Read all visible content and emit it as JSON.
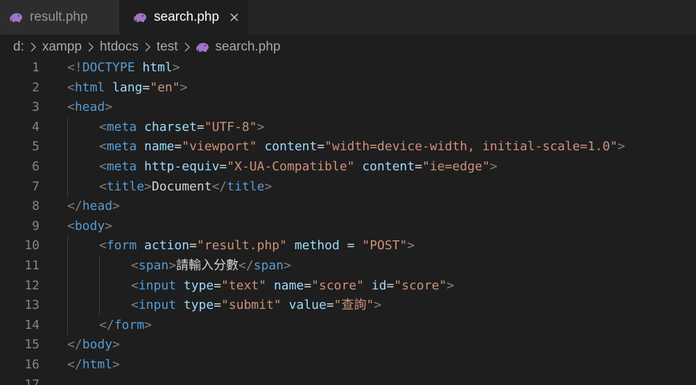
{
  "tabs": [
    {
      "label": "result.php",
      "active": false,
      "icon": "php-elephant-icon"
    },
    {
      "label": "search.php",
      "active": true,
      "icon": "php-elephant-icon",
      "close_icon": "close-icon"
    }
  ],
  "breadcrumb": {
    "items": [
      "d:",
      "xampp",
      "htdocs",
      "test"
    ],
    "file": "search.php",
    "separator_icon": "chevron-right-icon"
  },
  "editor": {
    "lines": [
      {
        "n": "1",
        "indent": 0,
        "tokens": [
          {
            "t": "punc",
            "v": "<!"
          },
          {
            "t": "tag",
            "v": "DOCTYPE"
          },
          {
            "t": "text",
            "v": " "
          },
          {
            "t": "attr",
            "v": "html"
          },
          {
            "t": "punc",
            "v": ">"
          }
        ]
      },
      {
        "n": "2",
        "indent": 0,
        "tokens": [
          {
            "t": "punc",
            "v": "<"
          },
          {
            "t": "tag",
            "v": "html"
          },
          {
            "t": "text",
            "v": " "
          },
          {
            "t": "attr",
            "v": "lang"
          },
          {
            "t": "text",
            "v": "="
          },
          {
            "t": "str",
            "v": "\"en\""
          },
          {
            "t": "punc",
            "v": ">"
          }
        ]
      },
      {
        "n": "3",
        "indent": 0,
        "tokens": [
          {
            "t": "punc",
            "v": "<"
          },
          {
            "t": "tag",
            "v": "head"
          },
          {
            "t": "punc",
            "v": ">"
          }
        ]
      },
      {
        "n": "4",
        "indent": 1,
        "tokens": [
          {
            "t": "punc",
            "v": "<"
          },
          {
            "t": "tag",
            "v": "meta"
          },
          {
            "t": "text",
            "v": " "
          },
          {
            "t": "attr",
            "v": "charset"
          },
          {
            "t": "text",
            "v": "="
          },
          {
            "t": "str",
            "v": "\"UTF-8\""
          },
          {
            "t": "punc",
            "v": ">"
          }
        ]
      },
      {
        "n": "5",
        "indent": 1,
        "tokens": [
          {
            "t": "punc",
            "v": "<"
          },
          {
            "t": "tag",
            "v": "meta"
          },
          {
            "t": "text",
            "v": " "
          },
          {
            "t": "attr",
            "v": "name"
          },
          {
            "t": "text",
            "v": "="
          },
          {
            "t": "str",
            "v": "\"viewport\""
          },
          {
            "t": "text",
            "v": " "
          },
          {
            "t": "attr",
            "v": "content"
          },
          {
            "t": "text",
            "v": "="
          },
          {
            "t": "str",
            "v": "\"width=device-width, initial-scale=1.0\""
          },
          {
            "t": "punc",
            "v": ">"
          }
        ]
      },
      {
        "n": "6",
        "indent": 1,
        "tokens": [
          {
            "t": "punc",
            "v": "<"
          },
          {
            "t": "tag",
            "v": "meta"
          },
          {
            "t": "text",
            "v": " "
          },
          {
            "t": "attr",
            "v": "http-equiv"
          },
          {
            "t": "text",
            "v": "="
          },
          {
            "t": "str",
            "v": "\"X-UA-Compatible\""
          },
          {
            "t": "text",
            "v": " "
          },
          {
            "t": "attr",
            "v": "content"
          },
          {
            "t": "text",
            "v": "="
          },
          {
            "t": "str",
            "v": "\"ie=edge\""
          },
          {
            "t": "punc",
            "v": ">"
          }
        ]
      },
      {
        "n": "7",
        "indent": 1,
        "tokens": [
          {
            "t": "punc",
            "v": "<"
          },
          {
            "t": "tag",
            "v": "title"
          },
          {
            "t": "punc",
            "v": ">"
          },
          {
            "t": "text",
            "v": "Document"
          },
          {
            "t": "punc",
            "v": "</"
          },
          {
            "t": "tag",
            "v": "title"
          },
          {
            "t": "punc",
            "v": ">"
          }
        ]
      },
      {
        "n": "8",
        "indent": 0,
        "tokens": [
          {
            "t": "punc",
            "v": "</"
          },
          {
            "t": "tag",
            "v": "head"
          },
          {
            "t": "punc",
            "v": ">"
          }
        ]
      },
      {
        "n": "9",
        "indent": 0,
        "tokens": [
          {
            "t": "punc",
            "v": "<"
          },
          {
            "t": "tag",
            "v": "body"
          },
          {
            "t": "punc",
            "v": ">"
          }
        ]
      },
      {
        "n": "10",
        "indent": 1,
        "tokens": [
          {
            "t": "punc",
            "v": "<"
          },
          {
            "t": "tag",
            "v": "form"
          },
          {
            "t": "text",
            "v": " "
          },
          {
            "t": "attr",
            "v": "action"
          },
          {
            "t": "text",
            "v": "="
          },
          {
            "t": "str",
            "v": "\"result.php\""
          },
          {
            "t": "text",
            "v": " "
          },
          {
            "t": "attr",
            "v": "method"
          },
          {
            "t": "text",
            "v": " = "
          },
          {
            "t": "str",
            "v": "\"POST\""
          },
          {
            "t": "punc",
            "v": ">"
          }
        ]
      },
      {
        "n": "11",
        "indent": 2,
        "tokens": [
          {
            "t": "punc",
            "v": "<"
          },
          {
            "t": "tag",
            "v": "span"
          },
          {
            "t": "punc",
            "v": ">"
          },
          {
            "t": "text",
            "v": "請輸入分數"
          },
          {
            "t": "punc",
            "v": "</"
          },
          {
            "t": "tag",
            "v": "span"
          },
          {
            "t": "punc",
            "v": ">"
          }
        ]
      },
      {
        "n": "12",
        "indent": 2,
        "tokens": [
          {
            "t": "punc",
            "v": "<"
          },
          {
            "t": "tag",
            "v": "input"
          },
          {
            "t": "text",
            "v": " "
          },
          {
            "t": "attr",
            "v": "type"
          },
          {
            "t": "text",
            "v": "="
          },
          {
            "t": "str",
            "v": "\"text\""
          },
          {
            "t": "text",
            "v": " "
          },
          {
            "t": "attr",
            "v": "name"
          },
          {
            "t": "text",
            "v": "="
          },
          {
            "t": "str",
            "v": "\"score\""
          },
          {
            "t": "text",
            "v": " "
          },
          {
            "t": "attr",
            "v": "id"
          },
          {
            "t": "text",
            "v": "="
          },
          {
            "t": "str",
            "v": "\"score\""
          },
          {
            "t": "punc",
            "v": ">"
          }
        ]
      },
      {
        "n": "13",
        "indent": 2,
        "tokens": [
          {
            "t": "punc",
            "v": "<"
          },
          {
            "t": "tag",
            "v": "input"
          },
          {
            "t": "text",
            "v": " "
          },
          {
            "t": "attr",
            "v": "type"
          },
          {
            "t": "text",
            "v": "="
          },
          {
            "t": "str",
            "v": "\"submit\""
          },
          {
            "t": "text",
            "v": " "
          },
          {
            "t": "attr",
            "v": "value"
          },
          {
            "t": "text",
            "v": "="
          },
          {
            "t": "str",
            "v": "\"查詢\""
          },
          {
            "t": "punc",
            "v": ">"
          }
        ]
      },
      {
        "n": "14",
        "indent": 1,
        "tokens": [
          {
            "t": "punc",
            "v": "</"
          },
          {
            "t": "tag",
            "v": "form"
          },
          {
            "t": "punc",
            "v": ">"
          }
        ]
      },
      {
        "n": "15",
        "indent": 0,
        "tokens": [
          {
            "t": "punc",
            "v": "</"
          },
          {
            "t": "tag",
            "v": "body"
          },
          {
            "t": "punc",
            "v": ">"
          }
        ]
      },
      {
        "n": "16",
        "indent": 0,
        "tokens": [
          {
            "t": "punc",
            "v": "</"
          },
          {
            "t": "tag",
            "v": "html"
          },
          {
            "t": "punc",
            "v": ">"
          }
        ]
      },
      {
        "n": "17",
        "indent": 0,
        "tokens": []
      }
    ]
  },
  "colors": {
    "background": "#1e1e1e",
    "tab_inactive_bg": "#2d2d2d",
    "tag": "#569cd6",
    "attribute": "#9cdcfe",
    "string": "#ce9178",
    "punctuation": "#808080",
    "text": "#d4d4d4",
    "line_number": "#858585",
    "php_icon": "#a074c4"
  }
}
